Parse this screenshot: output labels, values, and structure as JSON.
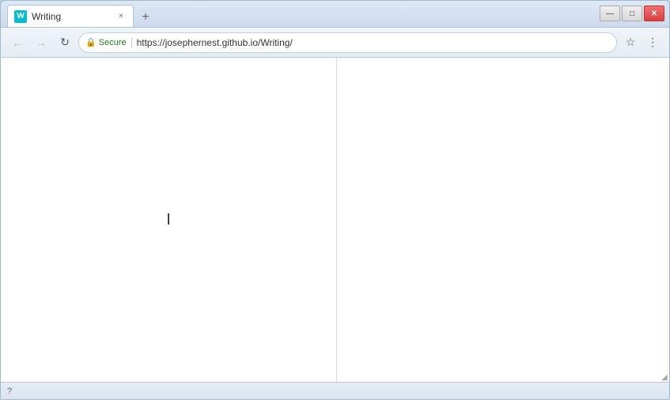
{
  "window": {
    "title": "Writing",
    "favicon_letter": "W",
    "tab_close_label": "×"
  },
  "browser": {
    "back_icon": "←",
    "forward_icon": "→",
    "refresh_icon": "↻",
    "secure_label": "Secure",
    "url": "https://josephernest.github.io/Writing/",
    "bookmark_icon": "☆",
    "menu_icon": "⋮",
    "new_tab_icon": "+"
  },
  "window_controls": {
    "minimize_label": "—",
    "maximize_label": "□",
    "close_label": "✕"
  },
  "status_bar": {
    "text": "?"
  },
  "content": {
    "cursor_char": "I",
    "resize_char": "◢"
  }
}
